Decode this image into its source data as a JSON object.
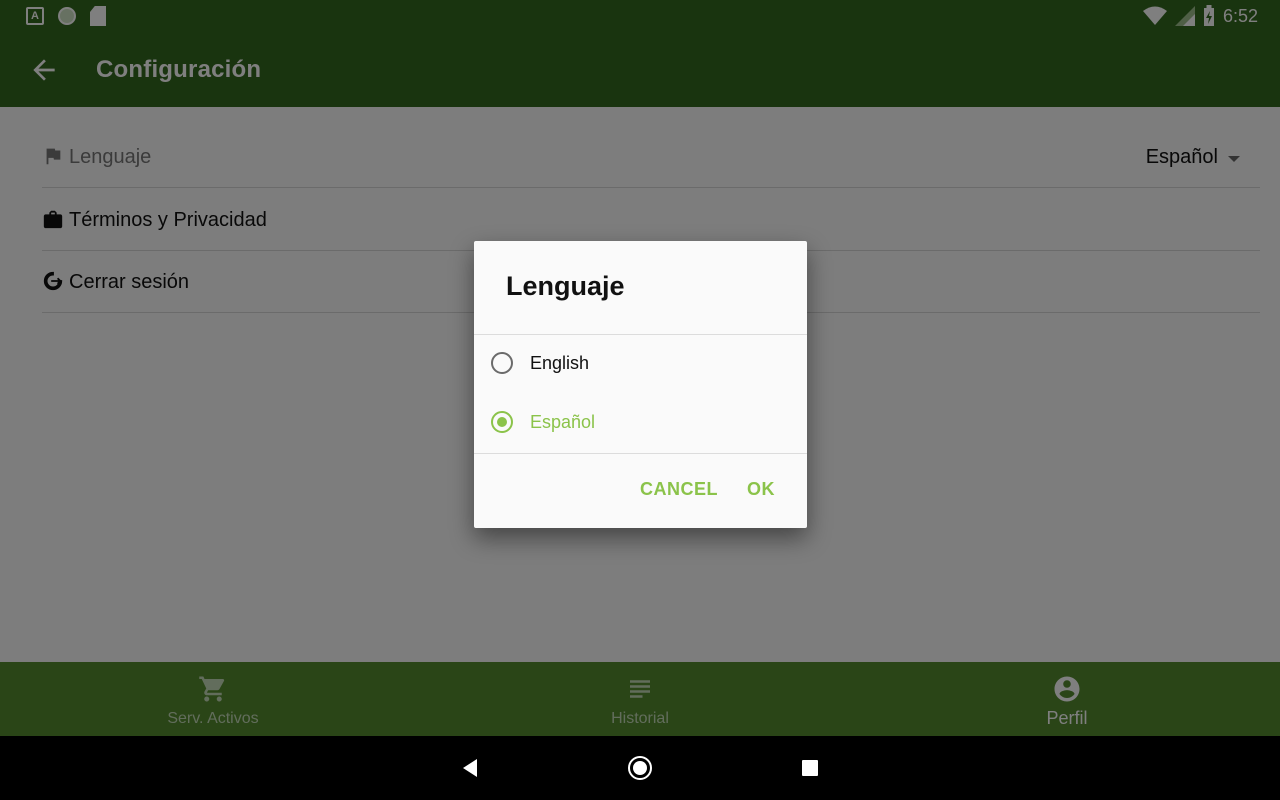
{
  "status_bar": {
    "time": "6:52"
  },
  "app_bar": {
    "title": "Configuración"
  },
  "settings": {
    "language": {
      "label": "Lenguaje",
      "value": "Español"
    },
    "terms": {
      "label": "Términos y Privacidad"
    },
    "logout": {
      "label": "Cerrar sesión"
    }
  },
  "bottom_nav": {
    "items": [
      {
        "label": "Serv. Activos",
        "icon": "cart-icon"
      },
      {
        "label": "Historial",
        "icon": "list-icon"
      },
      {
        "label": "Perfil",
        "icon": "account-icon",
        "active": true
      }
    ]
  },
  "dialog": {
    "title": "Lenguaje",
    "options": [
      {
        "label": "English",
        "selected": false
      },
      {
        "label": "Español",
        "selected": true
      }
    ],
    "cancel_label": "CANCEL",
    "ok_label": "OK"
  },
  "colors": {
    "primary_dark": "#33691e",
    "primary": "#558b2f",
    "accent": "#8bc34a"
  }
}
